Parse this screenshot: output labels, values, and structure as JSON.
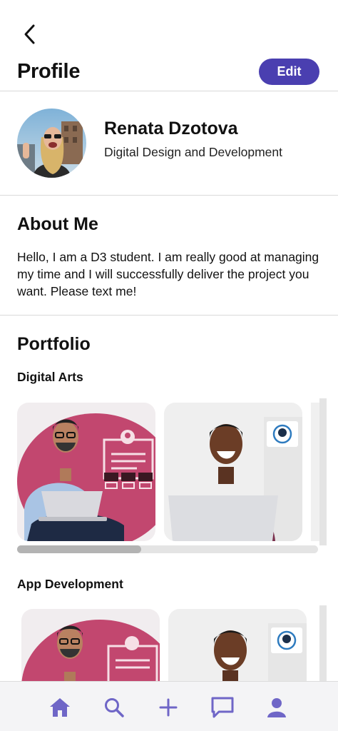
{
  "header": {
    "title": "Profile",
    "edit_label": "Edit"
  },
  "profile": {
    "name": "Renata Dzotova",
    "role": "Digital Design and Development"
  },
  "about": {
    "heading": "About Me",
    "text": "Hello, I am a D3 student. I am really good at managing my time and I will successfully deliver the project you want. Please text me!"
  },
  "portfolio": {
    "heading": "Portfolio",
    "categories": [
      {
        "title": "Digital Arts"
      },
      {
        "title": "App Development"
      }
    ]
  },
  "nav": {
    "items": [
      {
        "icon": "home-icon"
      },
      {
        "icon": "search-icon"
      },
      {
        "icon": "plus-icon"
      },
      {
        "icon": "chat-icon"
      },
      {
        "icon": "user-icon"
      }
    ]
  },
  "colors": {
    "accent": "#4a3fb0",
    "nav_icon": "#6f66c7",
    "card_pink": "#c2476f"
  }
}
